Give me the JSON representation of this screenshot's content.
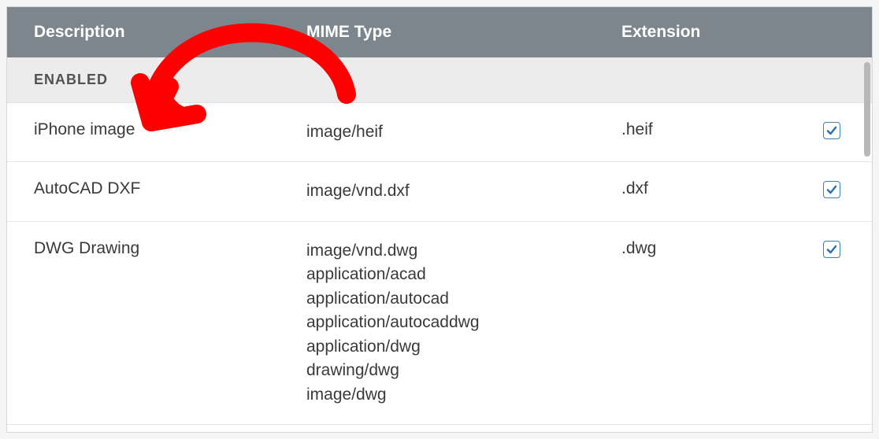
{
  "header": {
    "description": "Description",
    "mime": "MIME Type",
    "extension": "Extension"
  },
  "section_label": "ENABLED",
  "rows": [
    {
      "description": "iPhone image",
      "mime": "image/heif",
      "extension": ".heif",
      "checked": true
    },
    {
      "description": "AutoCAD DXF",
      "mime": "image/vnd.dxf",
      "extension": ".dxf",
      "checked": true
    },
    {
      "description": "DWG Drawing",
      "mime": "image/vnd.dwg\napplication/acad\napplication/autocad\napplication/autocaddwg\napplication/dwg\ndrawing/dwg\nimage/dwg",
      "extension": ".dwg",
      "checked": true
    }
  ]
}
